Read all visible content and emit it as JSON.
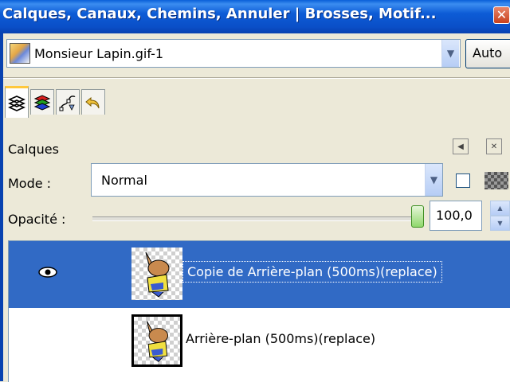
{
  "window": {
    "title": "Calques, Canaux, Chemins, Annuler | Brosses, Motif..."
  },
  "image_selector": {
    "value": "Monsieur Lapin.gif-1",
    "auto_label": "Auto"
  },
  "tabs": [
    {
      "icon": "layers-icon"
    },
    {
      "icon": "channels-icon"
    },
    {
      "icon": "paths-icon"
    },
    {
      "icon": "undo-history-icon"
    }
  ],
  "layers_panel": {
    "title": "Calques",
    "mode_label": "Mode :",
    "mode_value": "Normal",
    "opacity_label": "Opacité :",
    "opacity_value": "100,0",
    "opacity_level": 100,
    "layers": [
      {
        "name": "Copie de Arrière-plan (500ms)(replace)",
        "visible": true,
        "selected": true
      },
      {
        "name": "Arrière-plan (500ms)(replace)",
        "visible": false,
        "selected": false
      }
    ]
  },
  "colors": {
    "titlebar": "#0a4fc8",
    "selection": "#316ac5",
    "active_tab_accent": "#ffc83c"
  }
}
